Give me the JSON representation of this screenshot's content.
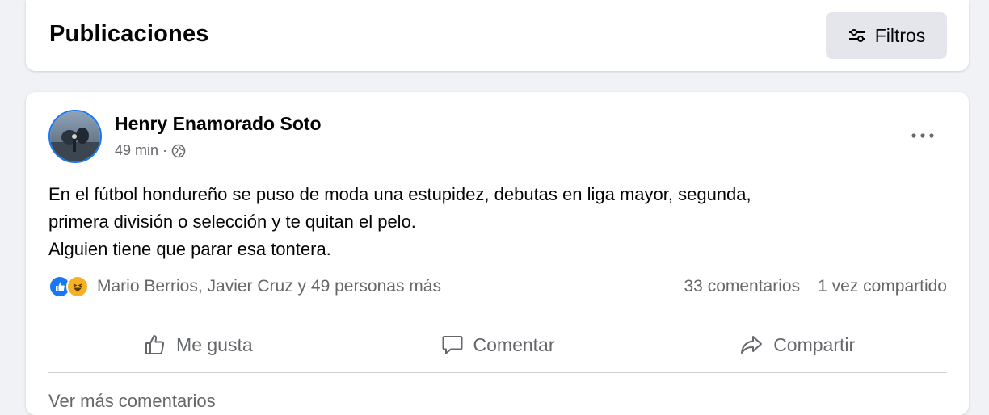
{
  "header": {
    "title": "Publicaciones",
    "filters_label": "Filtros",
    "filters_icon": "sliders-icon"
  },
  "post": {
    "author": "Henry Enamorado Soto",
    "time": "49 min",
    "separator": "·",
    "privacy_icon": "globe-icon",
    "text_lines": [
      "En el fútbol hondureño se puso de moda una estupidez, debutas  en liga mayor, segunda,",
      "primera división o selección y te quitan el pelo.",
      "Alguien tiene que parar esa tontera."
    ],
    "reactions": {
      "icons": [
        "like-reaction-icon",
        "haha-reaction-icon"
      ],
      "summary": "Mario Berrios, Javier Cruz y 49 personas más",
      "comments": "33 comentarios",
      "shares": "1 vez compartido"
    },
    "actions": {
      "like": "Me gusta",
      "comment": "Comentar",
      "share": "Compartir"
    },
    "see_more_comments": "Ver más comentarios"
  },
  "colors": {
    "accent": "#1877f2",
    "background": "#f0f2f5",
    "secondary_text": "#65676b",
    "button_bg": "#e4e6eb"
  }
}
